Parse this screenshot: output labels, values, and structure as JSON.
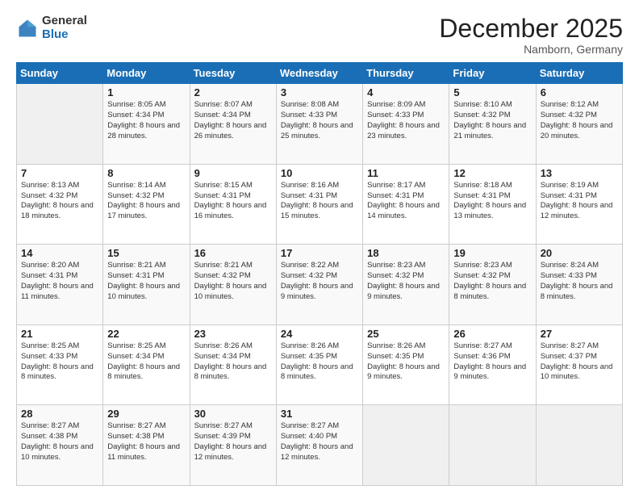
{
  "logo": {
    "general": "General",
    "blue": "Blue"
  },
  "title": "December 2025",
  "location": "Namborn, Germany",
  "days_header": [
    "Sunday",
    "Monday",
    "Tuesday",
    "Wednesday",
    "Thursday",
    "Friday",
    "Saturday"
  ],
  "weeks": [
    [
      {
        "day": "",
        "sunrise": "",
        "sunset": "",
        "daylight": ""
      },
      {
        "day": "1",
        "sunrise": "Sunrise: 8:05 AM",
        "sunset": "Sunset: 4:34 PM",
        "daylight": "Daylight: 8 hours and 28 minutes."
      },
      {
        "day": "2",
        "sunrise": "Sunrise: 8:07 AM",
        "sunset": "Sunset: 4:34 PM",
        "daylight": "Daylight: 8 hours and 26 minutes."
      },
      {
        "day": "3",
        "sunrise": "Sunrise: 8:08 AM",
        "sunset": "Sunset: 4:33 PM",
        "daylight": "Daylight: 8 hours and 25 minutes."
      },
      {
        "day": "4",
        "sunrise": "Sunrise: 8:09 AM",
        "sunset": "Sunset: 4:33 PM",
        "daylight": "Daylight: 8 hours and 23 minutes."
      },
      {
        "day": "5",
        "sunrise": "Sunrise: 8:10 AM",
        "sunset": "Sunset: 4:32 PM",
        "daylight": "Daylight: 8 hours and 21 minutes."
      },
      {
        "day": "6",
        "sunrise": "Sunrise: 8:12 AM",
        "sunset": "Sunset: 4:32 PM",
        "daylight": "Daylight: 8 hours and 20 minutes."
      }
    ],
    [
      {
        "day": "7",
        "sunrise": "Sunrise: 8:13 AM",
        "sunset": "Sunset: 4:32 PM",
        "daylight": "Daylight: 8 hours and 18 minutes."
      },
      {
        "day": "8",
        "sunrise": "Sunrise: 8:14 AM",
        "sunset": "Sunset: 4:32 PM",
        "daylight": "Daylight: 8 hours and 17 minutes."
      },
      {
        "day": "9",
        "sunrise": "Sunrise: 8:15 AM",
        "sunset": "Sunset: 4:31 PM",
        "daylight": "Daylight: 8 hours and 16 minutes."
      },
      {
        "day": "10",
        "sunrise": "Sunrise: 8:16 AM",
        "sunset": "Sunset: 4:31 PM",
        "daylight": "Daylight: 8 hours and 15 minutes."
      },
      {
        "day": "11",
        "sunrise": "Sunrise: 8:17 AM",
        "sunset": "Sunset: 4:31 PM",
        "daylight": "Daylight: 8 hours and 14 minutes."
      },
      {
        "day": "12",
        "sunrise": "Sunrise: 8:18 AM",
        "sunset": "Sunset: 4:31 PM",
        "daylight": "Daylight: 8 hours and 13 minutes."
      },
      {
        "day": "13",
        "sunrise": "Sunrise: 8:19 AM",
        "sunset": "Sunset: 4:31 PM",
        "daylight": "Daylight: 8 hours and 12 minutes."
      }
    ],
    [
      {
        "day": "14",
        "sunrise": "Sunrise: 8:20 AM",
        "sunset": "Sunset: 4:31 PM",
        "daylight": "Daylight: 8 hours and 11 minutes."
      },
      {
        "day": "15",
        "sunrise": "Sunrise: 8:21 AM",
        "sunset": "Sunset: 4:31 PM",
        "daylight": "Daylight: 8 hours and 10 minutes."
      },
      {
        "day": "16",
        "sunrise": "Sunrise: 8:21 AM",
        "sunset": "Sunset: 4:32 PM",
        "daylight": "Daylight: 8 hours and 10 minutes."
      },
      {
        "day": "17",
        "sunrise": "Sunrise: 8:22 AM",
        "sunset": "Sunset: 4:32 PM",
        "daylight": "Daylight: 8 hours and 9 minutes."
      },
      {
        "day": "18",
        "sunrise": "Sunrise: 8:23 AM",
        "sunset": "Sunset: 4:32 PM",
        "daylight": "Daylight: 8 hours and 9 minutes."
      },
      {
        "day": "19",
        "sunrise": "Sunrise: 8:23 AM",
        "sunset": "Sunset: 4:32 PM",
        "daylight": "Daylight: 8 hours and 8 minutes."
      },
      {
        "day": "20",
        "sunrise": "Sunrise: 8:24 AM",
        "sunset": "Sunset: 4:33 PM",
        "daylight": "Daylight: 8 hours and 8 minutes."
      }
    ],
    [
      {
        "day": "21",
        "sunrise": "Sunrise: 8:25 AM",
        "sunset": "Sunset: 4:33 PM",
        "daylight": "Daylight: 8 hours and 8 minutes."
      },
      {
        "day": "22",
        "sunrise": "Sunrise: 8:25 AM",
        "sunset": "Sunset: 4:34 PM",
        "daylight": "Daylight: 8 hours and 8 minutes."
      },
      {
        "day": "23",
        "sunrise": "Sunrise: 8:26 AM",
        "sunset": "Sunset: 4:34 PM",
        "daylight": "Daylight: 8 hours and 8 minutes."
      },
      {
        "day": "24",
        "sunrise": "Sunrise: 8:26 AM",
        "sunset": "Sunset: 4:35 PM",
        "daylight": "Daylight: 8 hours and 8 minutes."
      },
      {
        "day": "25",
        "sunrise": "Sunrise: 8:26 AM",
        "sunset": "Sunset: 4:35 PM",
        "daylight": "Daylight: 8 hours and 9 minutes."
      },
      {
        "day": "26",
        "sunrise": "Sunrise: 8:27 AM",
        "sunset": "Sunset: 4:36 PM",
        "daylight": "Daylight: 8 hours and 9 minutes."
      },
      {
        "day": "27",
        "sunrise": "Sunrise: 8:27 AM",
        "sunset": "Sunset: 4:37 PM",
        "daylight": "Daylight: 8 hours and 10 minutes."
      }
    ],
    [
      {
        "day": "28",
        "sunrise": "Sunrise: 8:27 AM",
        "sunset": "Sunset: 4:38 PM",
        "daylight": "Daylight: 8 hours and 10 minutes."
      },
      {
        "day": "29",
        "sunrise": "Sunrise: 8:27 AM",
        "sunset": "Sunset: 4:38 PM",
        "daylight": "Daylight: 8 hours and 11 minutes."
      },
      {
        "day": "30",
        "sunrise": "Sunrise: 8:27 AM",
        "sunset": "Sunset: 4:39 PM",
        "daylight": "Daylight: 8 hours and 12 minutes."
      },
      {
        "day": "31",
        "sunrise": "Sunrise: 8:27 AM",
        "sunset": "Sunset: 4:40 PM",
        "daylight": "Daylight: 8 hours and 12 minutes."
      },
      {
        "day": "",
        "sunrise": "",
        "sunset": "",
        "daylight": ""
      },
      {
        "day": "",
        "sunrise": "",
        "sunset": "",
        "daylight": ""
      },
      {
        "day": "",
        "sunrise": "",
        "sunset": "",
        "daylight": ""
      }
    ]
  ]
}
